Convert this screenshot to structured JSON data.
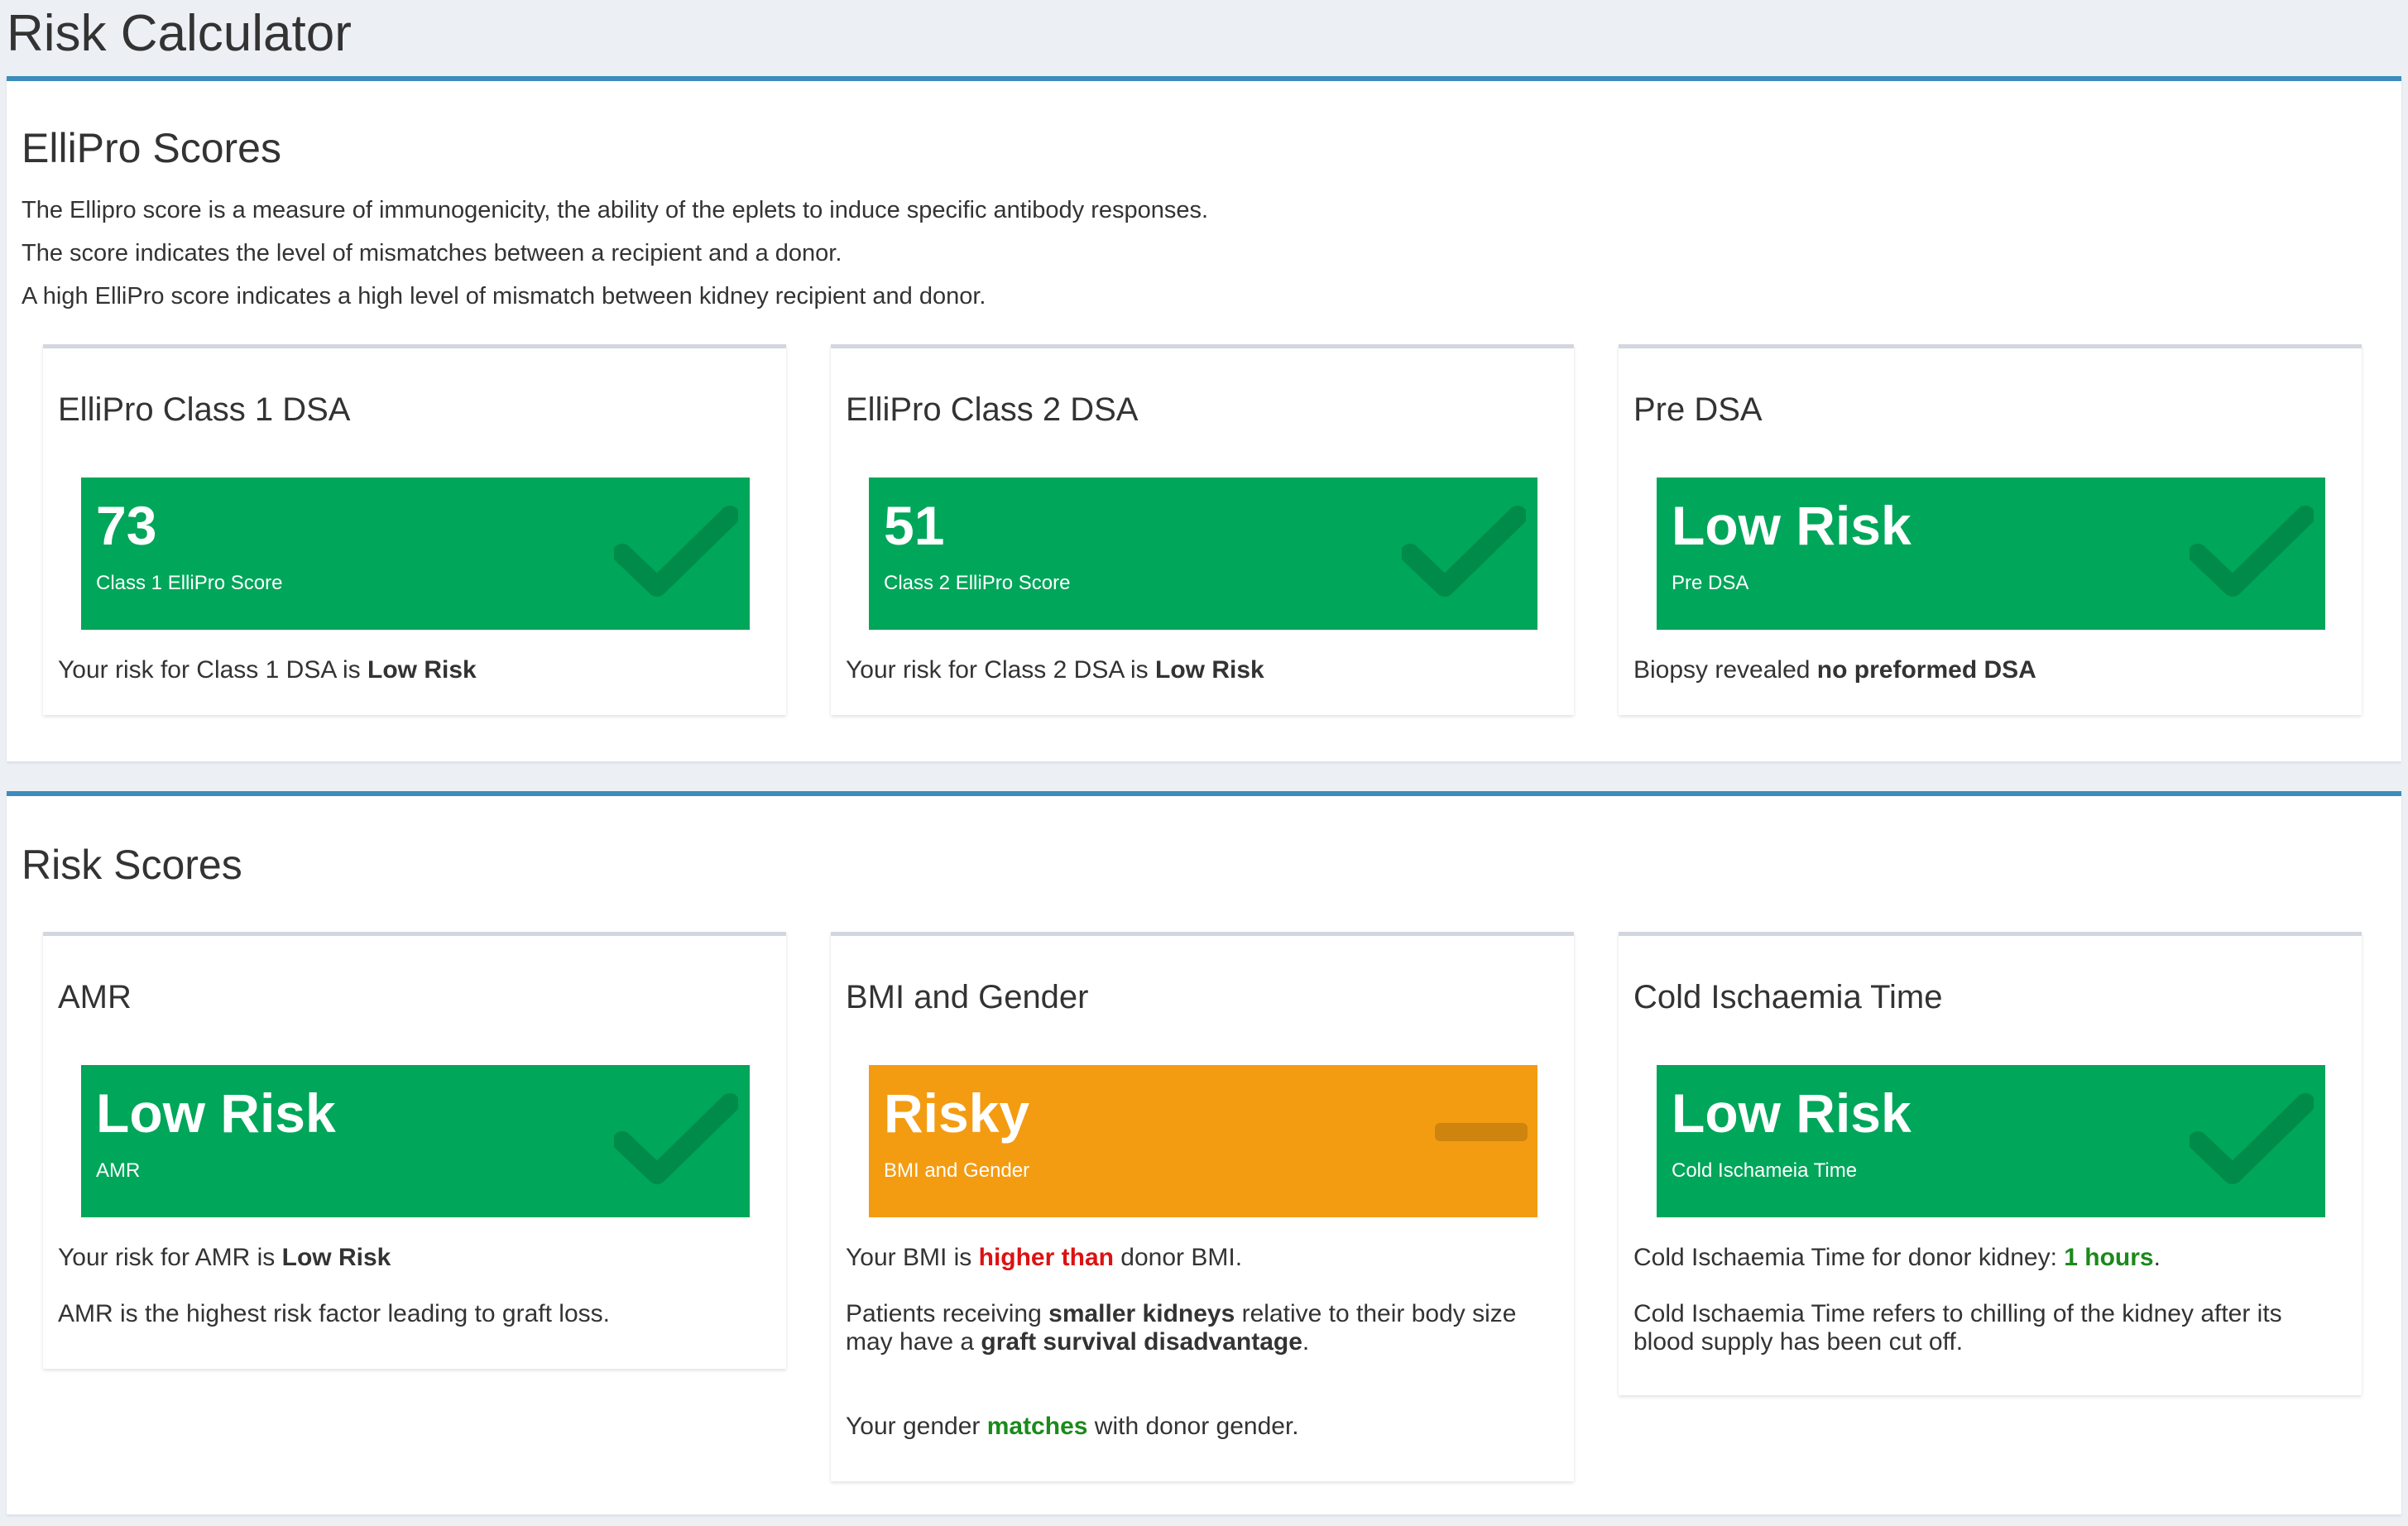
{
  "page": {
    "title": "Risk Calculator"
  },
  "ellipro": {
    "title": "ElliPro Scores",
    "description": [
      "The Ellipro score is a measure of immunogenicity, the ability of the eplets to induce specific antibody responses.",
      "The score indicates the level of mismatches between a recipient and a donor.",
      "A high ElliPro score indicates a high level of mismatch between kidney recipient and donor."
    ],
    "cards": [
      {
        "title": "ElliPro Class 1 DSA",
        "value": "73",
        "label": "Class 1 ElliPro Score",
        "text_prefix": "Your risk for Class 1 DSA is ",
        "text_bold": "Low Risk",
        "icon": "check-icon"
      },
      {
        "title": "ElliPro Class 2 DSA",
        "value": "51",
        "label": "Class 2 ElliPro Score",
        "text_prefix": "Your risk for Class 2 DSA is ",
        "text_bold": "Low Risk",
        "icon": "check-icon"
      },
      {
        "title": "Pre DSA",
        "value": "Low Risk",
        "label": "Pre DSA",
        "text_prefix": "Biopsy revealed ",
        "text_bold": "no preformed DSA",
        "icon": "check-icon"
      }
    ]
  },
  "risk": {
    "title": "Risk Scores",
    "amr": {
      "title": "AMR",
      "value": "Low Risk",
      "label": "AMR",
      "icon": "check-icon",
      "line1_prefix": "Your risk for AMR is ",
      "line1_bold": "Low Risk",
      "line2": "AMR is the highest risk factor leading to graft loss."
    },
    "bmi": {
      "title": "BMI and Gender",
      "value": "Risky",
      "label": "BMI and Gender",
      "icon": "minus-icon",
      "line1_prefix": "Your BMI is ",
      "line1_highlight": "higher than",
      "line1_suffix": " donor BMI.",
      "line2_a": "Patients receiving ",
      "line2_b": "smaller kidneys",
      "line2_c": " relative to their body size may have a ",
      "line2_d": "graft survival disadvantage",
      "line2_e": ".",
      "line3_prefix": "Your gender ",
      "line3_highlight": "matches",
      "line3_suffix": " with donor gender."
    },
    "cit": {
      "title": "Cold Ischaemia Time",
      "value": "Low Risk",
      "label": "Cold Ischameia Time",
      "icon": "check-icon",
      "line1_prefix": "Cold Ischaemia Time for donor kidney: ",
      "line1_highlight": "1 hours",
      "line1_suffix": ".",
      "line2": "Cold Ischaemia Time refers to chilling of the kidney after its blood supply has been cut off."
    }
  },
  "colors": {
    "green": "#00a65a",
    "orange": "#f39c12",
    "header_border": "#3c8dbc"
  }
}
